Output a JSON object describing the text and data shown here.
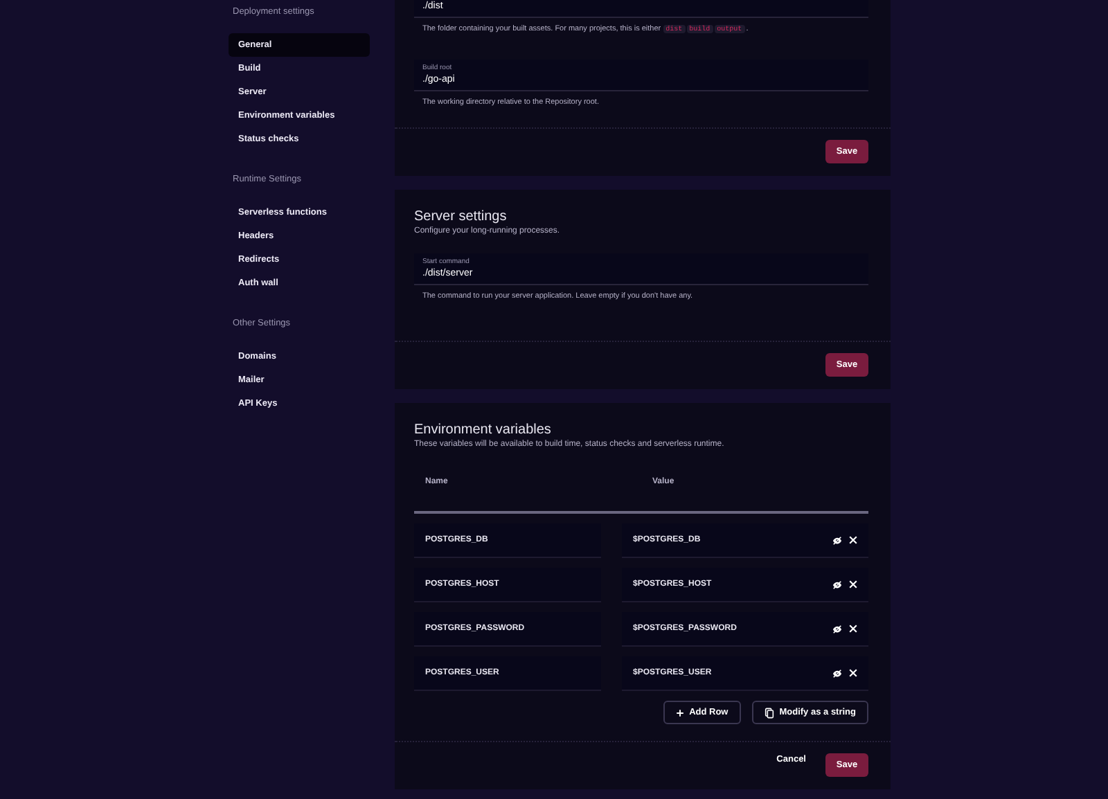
{
  "sidebar": {
    "sections": [
      {
        "title": "Deployment settings",
        "items": [
          {
            "label": "General",
            "selected": true
          },
          {
            "label": "Build",
            "selected": false
          },
          {
            "label": "Server",
            "selected": false
          },
          {
            "label": "Environment variables",
            "selected": false
          },
          {
            "label": "Status checks",
            "selected": false
          }
        ]
      },
      {
        "title": "Runtime Settings",
        "items": [
          {
            "label": "Serverless functions",
            "selected": false
          },
          {
            "label": "Headers",
            "selected": false
          },
          {
            "label": "Redirects",
            "selected": false
          },
          {
            "label": "Auth wall",
            "selected": false
          }
        ]
      },
      {
        "title": "Other Settings",
        "items": [
          {
            "label": "Domains",
            "selected": false
          },
          {
            "label": "Mailer",
            "selected": false
          },
          {
            "label": "API Keys",
            "selected": false
          }
        ]
      }
    ]
  },
  "build_card": {
    "fields": [
      {
        "value": "./dist",
        "help": "The folder containing your built assets. For many projects, this is either ",
        "codes": [
          "dist",
          "build",
          "output"
        ],
        "help_end": "."
      },
      {
        "label": "Build root",
        "value": "./go-api",
        "help": "The working directory relative to the Repository root."
      }
    ],
    "save": "Save"
  },
  "server_card": {
    "title": "Server settings",
    "subtitle": "Configure your long-running processes.",
    "fields": [
      {
        "label": "Start command",
        "value": "./dist/server",
        "help": "The command to run your server application. Leave empty if you don't have any."
      }
    ],
    "save": "Save"
  },
  "env_card": {
    "title": "Environment variables",
    "subtitle": "These variables will be available to build time, status checks and serverless runtime.",
    "columns": [
      "Name",
      "Value"
    ],
    "rows": [
      {
        "name": "POSTGRES_DB",
        "value": "$POSTGRES_DB"
      },
      {
        "name": "POSTGRES_HOST",
        "value": "$POSTGRES_HOST"
      },
      {
        "name": "POSTGRES_PASSWORD",
        "value": "$POSTGRES_PASSWORD"
      },
      {
        "name": "POSTGRES_USER",
        "value": "$POSTGRES_USER"
      }
    ],
    "add_row": "Add Row",
    "modify": "Modify as a string",
    "cancel": "Cancel",
    "save": "Save"
  }
}
